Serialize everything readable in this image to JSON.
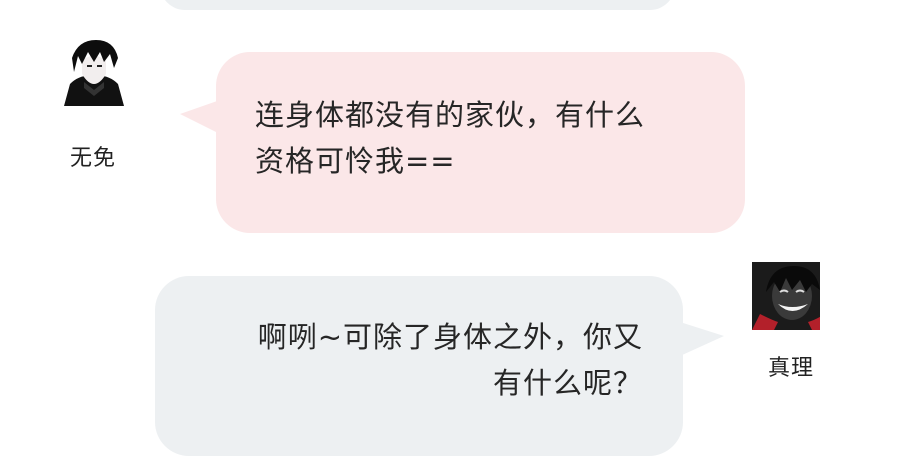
{
  "chat": {
    "messages": [
      {
        "sender": "无免",
        "lines": [
          "连身体都没有的家伙，有什么",
          "资格可怜我=="
        ]
      },
      {
        "sender": "真理",
        "lines": [
          "啊咧~可除了身体之外，你又",
          "有什么呢？"
        ]
      }
    ]
  },
  "colors": {
    "incoming_bubble": "#fbe7e8",
    "outgoing_bubble": "#edf0f2",
    "text": "#262626"
  },
  "icons": {
    "left_avatar": "dark-haired-character-avatar-icon",
    "right_avatar": "smiling-character-avatar-icon"
  }
}
